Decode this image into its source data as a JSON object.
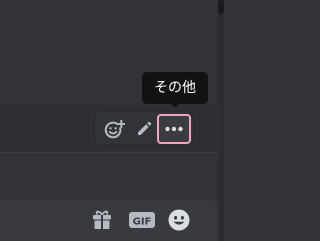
{
  "tooltip": {
    "label": "その他"
  },
  "message_toolbar": {
    "buttons": [
      {
        "name": "add-reaction",
        "icon": "emoji-add-icon"
      },
      {
        "name": "edit",
        "icon": "pencil-icon"
      },
      {
        "name": "more",
        "icon": "ellipsis-icon",
        "state": "focused"
      }
    ]
  },
  "composer": {
    "gif_label": "GIF",
    "icons": [
      "gift-icon",
      "gif-icon",
      "emoji-icon"
    ]
  },
  "colors": {
    "background": "#313338",
    "tooltip_bg": "#111214",
    "focus_ring": "#f0a4bc",
    "icon": "#b5bac1",
    "composer_bg": "#383a40"
  }
}
